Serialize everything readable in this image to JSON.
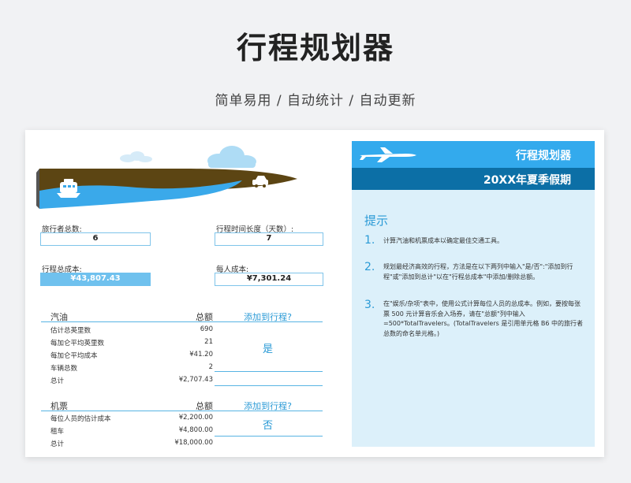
{
  "header": {
    "title": "行程规划器",
    "subtitle": "简单易用 / 自动统计 / 自动更新"
  },
  "fields": {
    "travelers_label": "旅行者总数:",
    "travelers_value": "6",
    "duration_label": "行程时间长度（天数）:",
    "duration_value": "7",
    "total_cost_label": "行程总成本:",
    "total_cost_value": "¥43,807.43",
    "per_person_label": "每人成本:",
    "per_person_value": "¥7,301.24"
  },
  "gas": {
    "title": "汽油",
    "amount_header": "总额",
    "add_header": "添加到行程?",
    "answer": "是",
    "rows": [
      {
        "label": "估计总英里数",
        "value": "690"
      },
      {
        "label": "每加仑平均英里数",
        "value": "21"
      },
      {
        "label": "每加仑平均成本",
        "value": "¥41.20"
      },
      {
        "label": "车辆总数",
        "value": "2"
      },
      {
        "label": "总计",
        "value": "¥2,707.43"
      }
    ]
  },
  "ticket": {
    "title": "机票",
    "amount_header": "总额",
    "add_header": "添加到行程?",
    "answer": "否",
    "rows": [
      {
        "label": "每位人员的估计成本",
        "value": "¥2,200.00"
      },
      {
        "label": "租车",
        "value": "¥4,800.00"
      },
      {
        "label": "总计",
        "value": "¥18,000.00"
      }
    ]
  },
  "panel": {
    "title": "行程规划器",
    "subtitle": "20XX年夏季假期",
    "hint_title": "提示",
    "tips": [
      {
        "num": "1.",
        "text": "计算汽油和机票成本以确定最佳交通工具。"
      },
      {
        "num": "2.",
        "text": "规划最经济高效的行程，方法是在以下两列中输入\"是/否\":\"添加到行程\"或\"添加到总计\"以在\"行程总成本\"中添加/删除总额。"
      },
      {
        "num": "3.",
        "text": "在\"娱乐/杂项\"表中，使用公式计算每位人员的总成本。例如，要按每张票 500 元计算音乐会入场券，请在\"总额\"列中输入 =500*TotalTravelers。(TotalTravelers 是引用单元格 B6 中的旅行者总数的命名单元格。)"
      }
    ]
  },
  "colors": {
    "accent": "#2a9ad6",
    "panel_bg": "#dcf0fa",
    "panel_top": "#33aaed",
    "panel_band": "#0c6fa6",
    "road": "#5c4513",
    "water": "#3aa9ea"
  }
}
